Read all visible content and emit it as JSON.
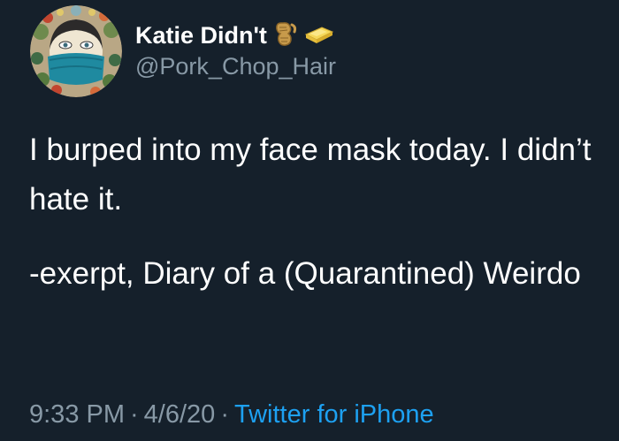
{
  "author": {
    "display_name": "Katie Didn't",
    "handle": "@Pork_Chop_Hair",
    "name_emojis": [
      "peanut-icon",
      "butter-icon"
    ]
  },
  "tweet": {
    "paragraphs": [
      "I burped into my face mask today. I didn’t hate it.",
      "-exerpt, Diary of a (Quarantined) Weirdo"
    ],
    "time": "9:33 PM",
    "separator": "·",
    "date": "4/6/20",
    "source": "Twitter for iPhone"
  },
  "colors": {
    "background": "#15202b",
    "primary_text": "#ffffff",
    "secondary_text": "#8899a6",
    "link": "#1da1f2"
  }
}
